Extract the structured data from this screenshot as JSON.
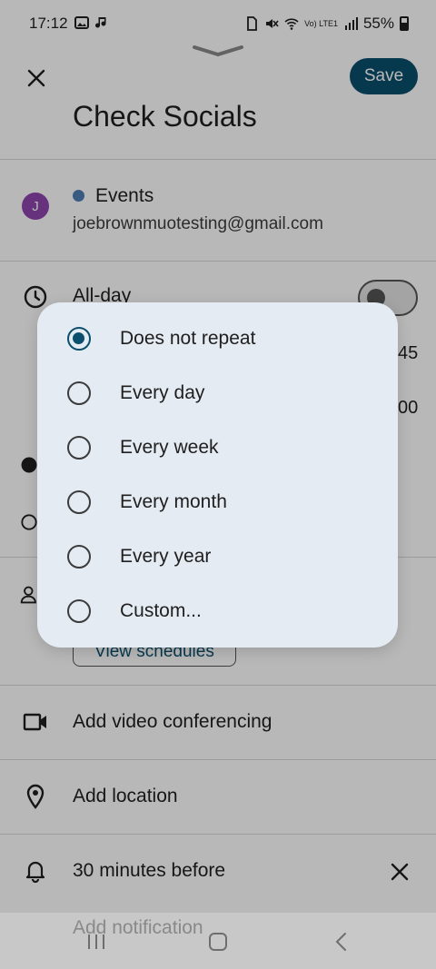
{
  "status_bar": {
    "time": "17:12",
    "battery": "55%",
    "network_label": "Vo) LTE1"
  },
  "header": {
    "title": "Check Socials",
    "save_label": "Save"
  },
  "calendar": {
    "avatar_initial": "J",
    "name": "Events",
    "email": "joebrownmuotesting@gmail.com",
    "dot_color": "#4f7fb4"
  },
  "all_day": {
    "label": "All-day",
    "enabled": false
  },
  "start_time_fragment": "45",
  "end_time_fragment": "00",
  "view_schedules_label": "View schedules",
  "rows": {
    "video": "Add video conferencing",
    "location": "Add location",
    "notification": "30 minutes before",
    "add_notification": "Add notification"
  },
  "repeat_dialog": {
    "selected_index": 0,
    "options": [
      "Does not repeat",
      "Every day",
      "Every week",
      "Every month",
      "Every year",
      "Custom..."
    ]
  },
  "colors": {
    "accent": "#0b4f6c",
    "dialog_bg": "#e4ebf2",
    "avatar": "#8e44ad"
  }
}
